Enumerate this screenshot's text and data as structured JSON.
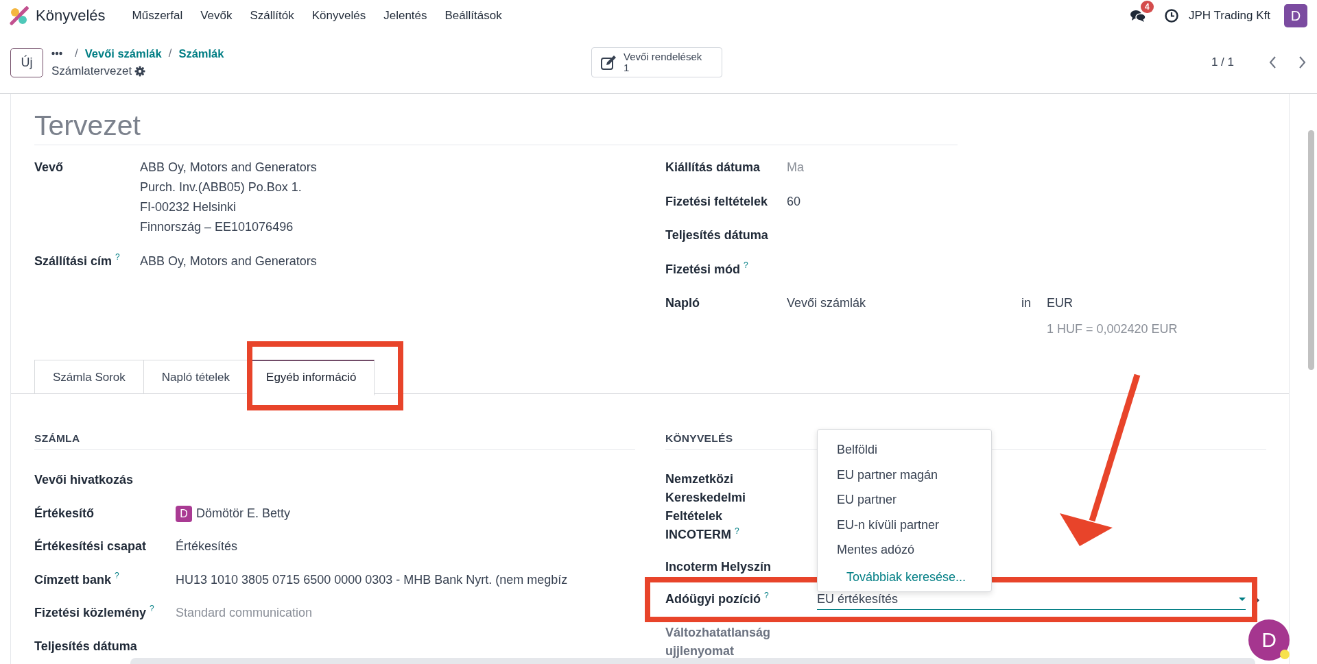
{
  "app": {
    "name": "Könyvelés"
  },
  "menu": [
    "Műszerfal",
    "Vevők",
    "Szállítók",
    "Könyvelés",
    "Jelentés",
    "Beállítások"
  ],
  "systray": {
    "messages_count": "4",
    "company": "JPH Trading Kft",
    "avatar": "D"
  },
  "control_bar": {
    "new_button": "Új",
    "separator": "/",
    "breadcrumbs": [
      "Vevői számlák",
      "Számlák"
    ],
    "record": "Számlatervezet",
    "smart_button": {
      "label": "Vevői rendelések",
      "count": "1"
    },
    "pager": "1 / 1"
  },
  "title": "Tervezet",
  "partner_fields": [
    {
      "label": "Vevő",
      "lines": [
        "ABB Oy, Motors and Generators",
        "Purch. Inv.(ABB05) Po.Box 1.",
        "FI-00232 Helsinki",
        "Finnország – EE101076496"
      ]
    },
    {
      "label": "Szállítási cím",
      "help": "?",
      "lines": [
        "ABB Oy, Motors and Generators"
      ]
    }
  ],
  "invoice_fields": [
    {
      "label": "Kiállítás dátuma",
      "placeholder": "Ma"
    },
    {
      "label": "Fizetési feltételek",
      "value": "60"
    },
    {
      "label": "Teljesítés dátuma"
    },
    {
      "label": "Fizetési mód",
      "help": "?"
    },
    {
      "label": "Napló",
      "value": "Vevői számlák",
      "separator": "in",
      "currency": "EUR",
      "rate": "1 HUF = 0,002420 EUR"
    }
  ],
  "tabs": [
    {
      "label": "Számla Sorok",
      "selected": false
    },
    {
      "label": "Napló tételek",
      "selected": false
    },
    {
      "label": "Egyéb információ",
      "selected": true
    }
  ],
  "invoice_section": {
    "heading": "SZÁMLA",
    "fields": [
      {
        "label": "Vevői hivatkozás"
      },
      {
        "label": "Értékesítő",
        "avatar": "D",
        "value": "Dömötör E. Betty"
      },
      {
        "label": "Értékesítési csapat",
        "value": "Értékesítés"
      },
      {
        "label": "Címzett bank",
        "help": "?",
        "value": "HU13 1010 3805 0715 6500 0000 0303 - MHB Bank Nyrt. (nem megbíz"
      },
      {
        "label": "Fizetési közlemény",
        "help": "?",
        "placeholder": "Standard communication"
      },
      {
        "label": "Teljesítés dátuma"
      }
    ]
  },
  "accounting_section": {
    "heading": "KÖNYVELÉS",
    "fields": [
      {
        "label": "Nemzetközi Kereskedelmi Feltételek INCOTERM",
        "help": "?",
        "kind": "text",
        "disabled": false
      },
      {
        "label": "Incoterm Helyszín",
        "kind": "text",
        "disabled": false
      },
      {
        "label": "Adóügyi pozíció",
        "help": "?",
        "kind": "select",
        "value": "EU értékesítés",
        "disabled": false
      },
      {
        "label": "Változhatatlanság ujjlenyomat",
        "kind": "text",
        "disabled": true
      }
    ]
  },
  "dropdown": {
    "options": [
      "Belföldi",
      "EU partner magán",
      "EU partner",
      "EU-n kívüli partner",
      "Mentes adózó"
    ],
    "search_more": "Továbbiak keresése..."
  },
  "chatter_avatar": "D"
}
